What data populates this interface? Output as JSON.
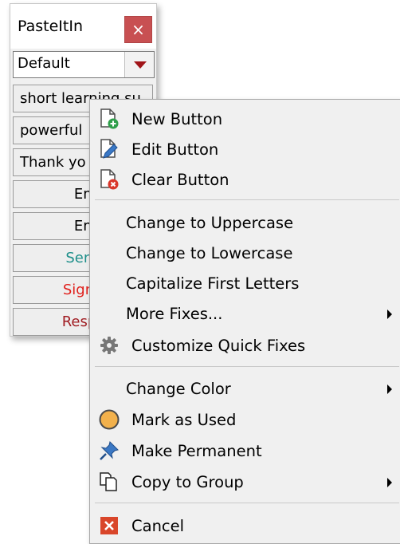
{
  "window": {
    "title": "PasteItIn",
    "close_label": "×",
    "group_select": {
      "value": "Default"
    },
    "buttons": [
      {
        "label": "short learning su",
        "color": "#000000"
      },
      {
        "label": "powerful",
        "color": "#000000"
      },
      {
        "label": "Thank yo",
        "color": "#000000"
      },
      {
        "label": "Emp",
        "color": "#000000"
      },
      {
        "label": "Emp",
        "color": "#000000"
      },
      {
        "label": "Send",
        "color": "#1e8f8a"
      },
      {
        "label": "Signa",
        "color": "#e0201c"
      },
      {
        "label": "Respo",
        "color": "#a01c22"
      }
    ]
  },
  "menu": {
    "items": [
      {
        "label": "New Button",
        "icon": "new-page-icon"
      },
      {
        "label": "Edit Button",
        "icon": "edit-page-icon"
      },
      {
        "label": "Clear Button",
        "icon": "clear-page-icon"
      },
      {
        "label": "Change to Uppercase"
      },
      {
        "label": "Change to Lowercase"
      },
      {
        "label": "Capitalize First Letters"
      },
      {
        "label": "More Fixes...",
        "submenu": true
      },
      {
        "label": "Customize Quick Fixes",
        "icon": "gear-icon"
      },
      {
        "label": "Change Color",
        "submenu": true
      },
      {
        "label": "Mark as Used",
        "icon": "orange-circle-icon"
      },
      {
        "label": "Make Permanent",
        "icon": "pushpin-icon"
      },
      {
        "label": "Copy to Group",
        "icon": "copy-group-icon",
        "submenu": true
      },
      {
        "label": "Cancel",
        "icon": "cancel-x-icon"
      }
    ]
  },
  "colors": {
    "close_button": "#c85052",
    "dropdown_arrow": "#a01418",
    "send_text": "#1e8f8a",
    "signature_text": "#e0201c",
    "response_text": "#a01c22",
    "cancel_icon": "#d9462a",
    "mark_used_icon": "#f2b14c"
  }
}
